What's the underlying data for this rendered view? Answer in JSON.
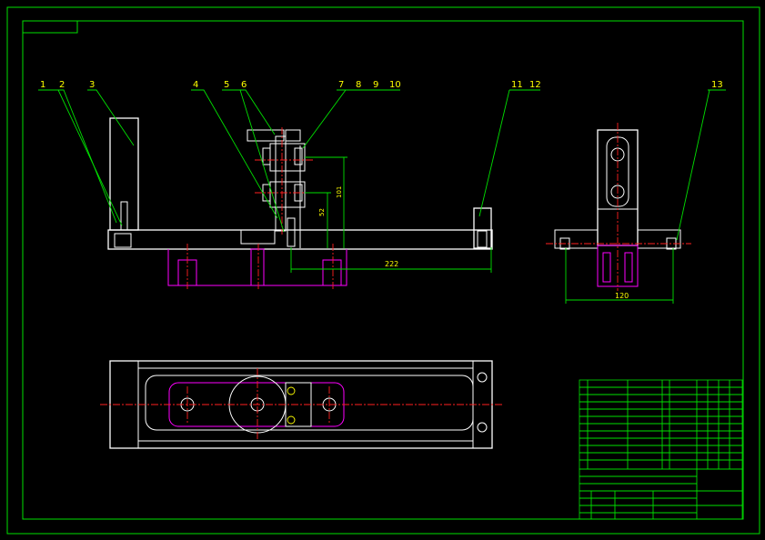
{
  "drawing": {
    "colors": {
      "background": "#000000",
      "outline": "#ffffff",
      "leader": "#00e000",
      "dimension_magenta": "#ff00ff",
      "centerline": "#ff2020",
      "text": "#ffff00",
      "frame": "#00ffff"
    },
    "balloons": [
      "1",
      "2",
      "3",
      "4",
      "5",
      "6",
      "7",
      "8",
      "9",
      "10",
      "11",
      "12",
      "13"
    ],
    "dimensions": {
      "length_main": "222",
      "height_small": "52",
      "height_large": "101",
      "width_side": "120"
    }
  }
}
